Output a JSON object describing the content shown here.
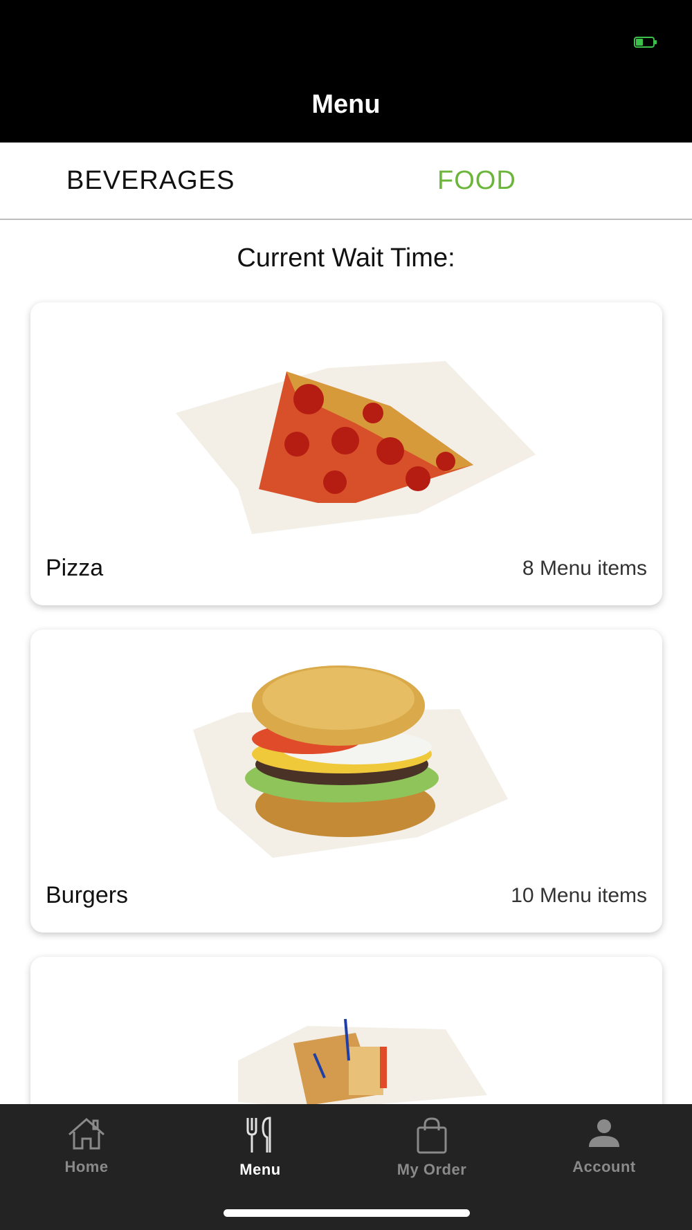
{
  "header": {
    "title": "Menu"
  },
  "status_bar": {
    "battery_icon": "battery-charging-icon",
    "battery_color": "#3cc14a"
  },
  "tabs": [
    {
      "label": "BEVERAGES",
      "active": false
    },
    {
      "label": "FOOD",
      "active": true
    }
  ],
  "accent_color": "#6bb53a",
  "wait_time": {
    "label": "Current Wait Time:"
  },
  "categories": [
    {
      "name": "Pizza",
      "count": "8 Menu items",
      "image_icon": "pizza-slice-image"
    },
    {
      "name": "Burgers",
      "count": "10 Menu items",
      "image_icon": "burger-image"
    },
    {
      "name": "",
      "count": "",
      "image_icon": "sandwich-image"
    }
  ],
  "bottom_nav": [
    {
      "label": "Home",
      "icon": "home-icon",
      "active": false
    },
    {
      "label": "Menu",
      "icon": "fork-knife-icon",
      "active": true
    },
    {
      "label": "My Order",
      "icon": "shopping-bag-icon",
      "active": false
    },
    {
      "label": "Account",
      "icon": "person-icon",
      "active": false
    }
  ]
}
